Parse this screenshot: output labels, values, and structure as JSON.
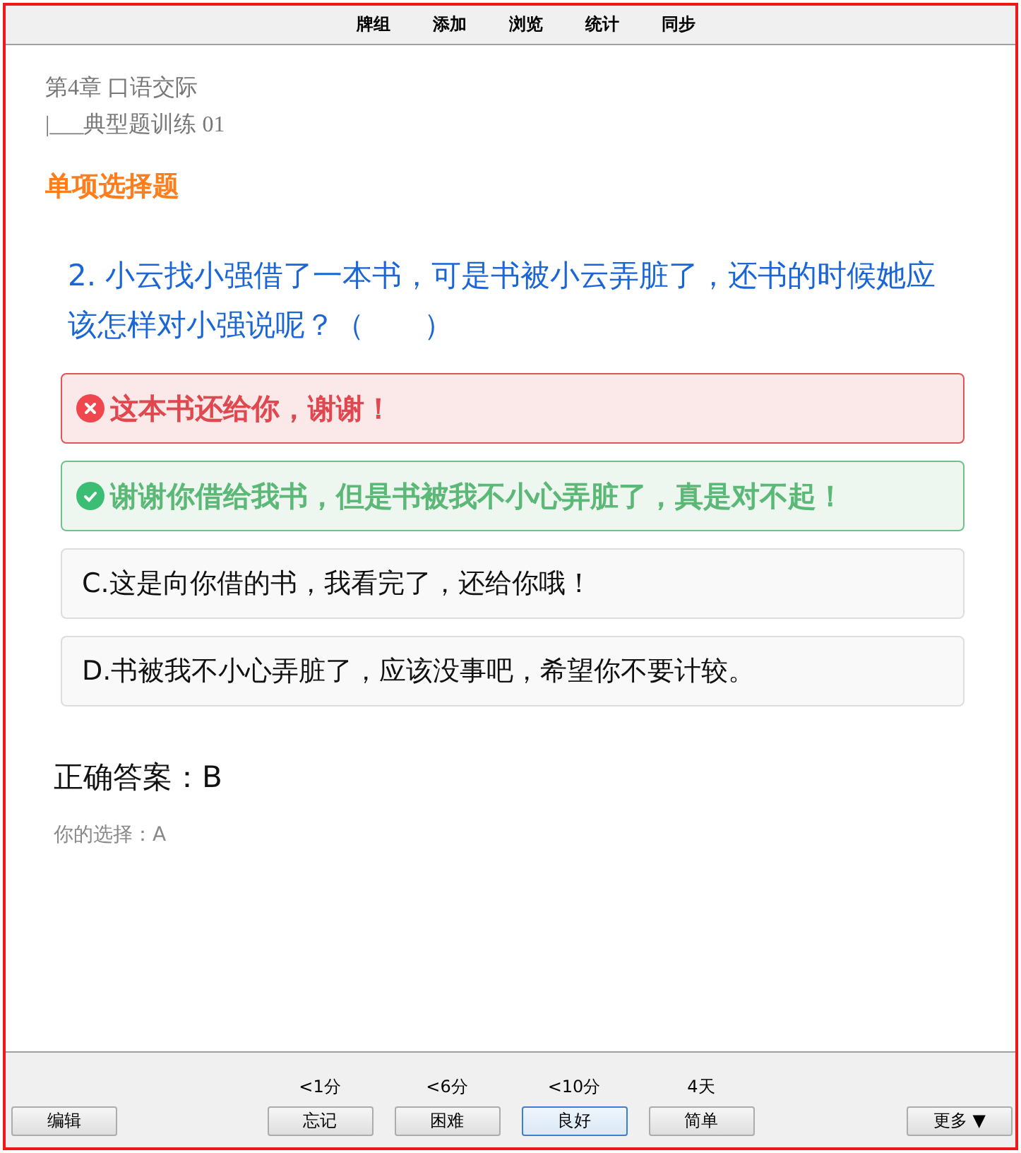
{
  "menu": [
    {
      "label": "牌组"
    },
    {
      "label": "添加"
    },
    {
      "label": "浏览"
    },
    {
      "label": "统计"
    },
    {
      "label": "同步"
    }
  ],
  "card": {
    "chapter": "第4章 口语交际",
    "section": "|___典型题训练 01",
    "heading": "单项选择题",
    "question": "2. 小云找小强借了一本书，可是书被小云弄脏了，还书的时候她应该怎样对小强说呢？（　　）",
    "options": [
      {
        "kind": "wrong",
        "text": "这本书还给你，谢谢！"
      },
      {
        "kind": "correct",
        "text": "谢谢你借给我书，但是书被我不小心弄脏了，真是对不起！"
      },
      {
        "kind": "plain",
        "text": "C.这是向你借的书，我看完了，还给你哦！"
      },
      {
        "kind": "plain",
        "text": "D.书被我不小心弄脏了，应该没事吧，希望你不要计较。"
      }
    ],
    "answer": "正确答案：B",
    "your_choice": "你的选择：A"
  },
  "bottom_bar": {
    "edit_button": "编辑",
    "answers": [
      {
        "interval": "<1分",
        "label": "忘记",
        "selected": false
      },
      {
        "interval": "<6分",
        "label": "困难",
        "selected": false
      },
      {
        "interval": "<10分",
        "label": "良好",
        "selected": true
      },
      {
        "interval": "4天",
        "label": "简单",
        "selected": false
      }
    ],
    "more_button": "更多 ▼"
  }
}
